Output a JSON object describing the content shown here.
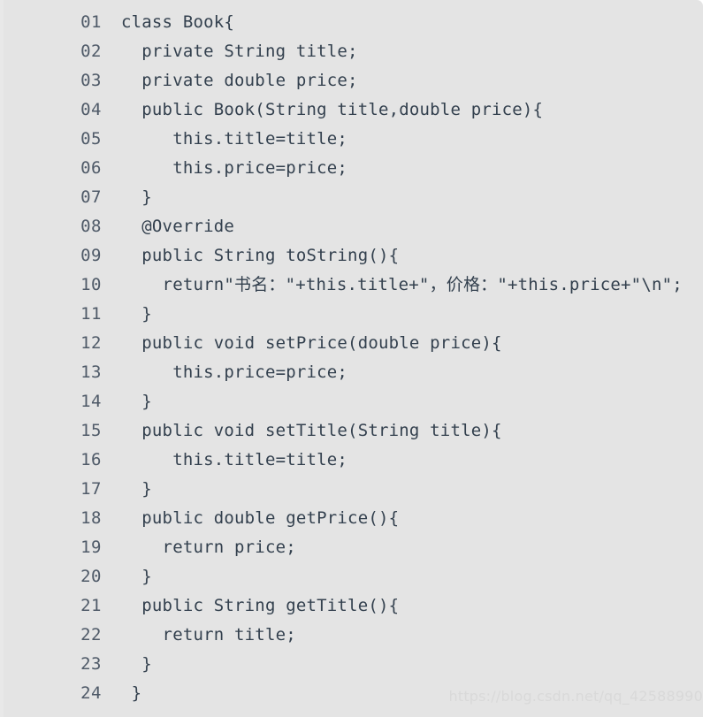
{
  "panel": {
    "background_color": "#e4e4e4",
    "page_background_color": "#ffffff",
    "code_text_color": "#33404e",
    "line_number_color": "#4f5a68",
    "watermark_color": "#d9d9d9"
  },
  "code": {
    "language": "java",
    "lines": [
      {
        "number": "01",
        "text": "class Book{"
      },
      {
        "number": "02",
        "text": "  private String title;"
      },
      {
        "number": "03",
        "text": "  private double price;"
      },
      {
        "number": "04",
        "text": "  public Book(String title,double price){"
      },
      {
        "number": "05",
        "text": "     this.title=title;"
      },
      {
        "number": "06",
        "text": "     this.price=price;"
      },
      {
        "number": "07",
        "text": "  }"
      },
      {
        "number": "08",
        "text": "  @Override"
      },
      {
        "number": "09",
        "text": "  public String toString(){"
      },
      {
        "number": "10",
        "text": "    return\"书名：\"+this.title+\"，价格：\"+this.price+\"\\n\";"
      },
      {
        "number": "11",
        "text": "  }"
      },
      {
        "number": "12",
        "text": "  public void setPrice(double price){"
      },
      {
        "number": "13",
        "text": "     this.price=price;"
      },
      {
        "number": "14",
        "text": "  }"
      },
      {
        "number": "15",
        "text": "  public void setTitle(String title){"
      },
      {
        "number": "16",
        "text": "     this.title=title;"
      },
      {
        "number": "17",
        "text": "  }"
      },
      {
        "number": "18",
        "text": "  public double getPrice(){"
      },
      {
        "number": "19",
        "text": "    return price;"
      },
      {
        "number": "20",
        "text": "  }"
      },
      {
        "number": "21",
        "text": "  public String getTitle(){"
      },
      {
        "number": "22",
        "text": "    return title;"
      },
      {
        "number": "23",
        "text": "  }"
      },
      {
        "number": "24",
        "text": " }"
      }
    ]
  },
  "watermark": {
    "text": "https://blog.csdn.net/qq_42588990"
  }
}
